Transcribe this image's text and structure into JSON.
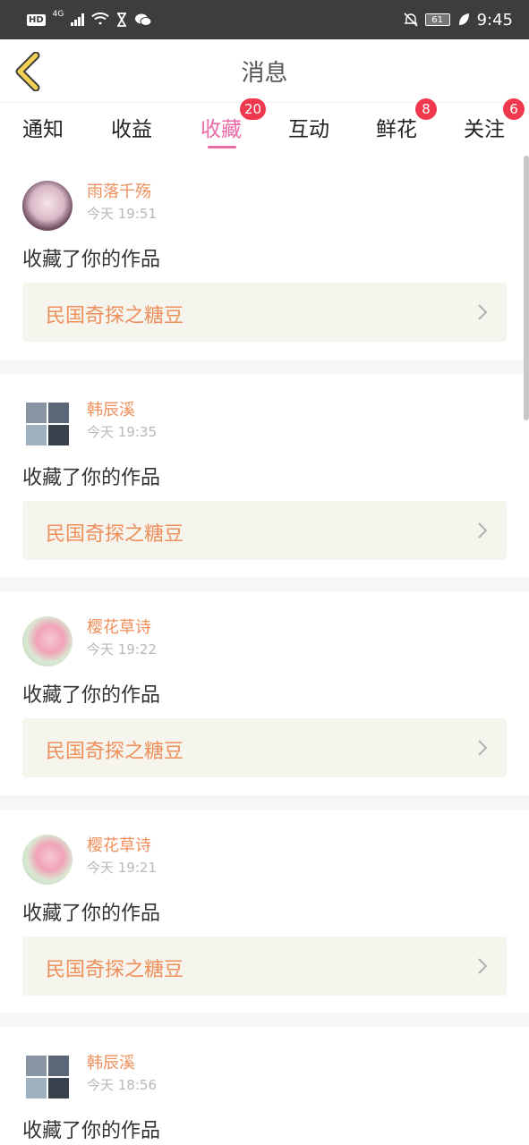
{
  "status_bar": {
    "hd": "HD",
    "network": "4G",
    "battery": "61",
    "time": "9:45",
    "icons": [
      "signal-icon",
      "wifi-icon",
      "hourglass-icon",
      "wechat-icon",
      "mute-icon",
      "leaf-icon"
    ]
  },
  "header": {
    "title": "消息",
    "back_icon": "chevron-left-icon"
  },
  "tabs": [
    {
      "label": "通知",
      "badge": ""
    },
    {
      "label": "收益",
      "badge": ""
    },
    {
      "label": "收藏",
      "badge": "20",
      "active": true
    },
    {
      "label": "互动",
      "badge": ""
    },
    {
      "label": "鲜花",
      "badge": "8"
    },
    {
      "label": "关注",
      "badge": "6"
    }
  ],
  "items": [
    {
      "name": "雨落千殇",
      "time": "今天 19:51",
      "action": "收藏了你的作品",
      "work": "民国奇探之糖豆"
    },
    {
      "name": "韩辰溪",
      "time": "今天 19:35",
      "action": "收藏了你的作品",
      "work": "民国奇探之糖豆"
    },
    {
      "name": "樱花草诗",
      "time": "今天 19:22",
      "action": "收藏了你的作品",
      "work": "民国奇探之糖豆"
    },
    {
      "name": "樱花草诗",
      "time": "今天 19:21",
      "action": "收藏了你的作品",
      "work": "民国奇探之糖豆"
    },
    {
      "name": "韩辰溪",
      "time": "今天 18:56",
      "action": "收藏了你的作品",
      "work": ""
    }
  ],
  "colors": {
    "accent": "#e86aa6",
    "name": "#ee8f5c",
    "badge": "#f0394f",
    "card": "#f5f5ee"
  }
}
